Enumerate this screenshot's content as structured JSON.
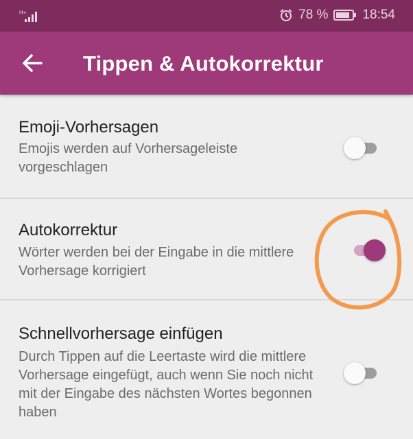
{
  "statusbar": {
    "battery": "78 %",
    "time": "18:54",
    "icons": [
      "signal-icon",
      "alarm-icon",
      "battery-icon"
    ]
  },
  "appbar": {
    "title": "Tippen & Autokorrektur",
    "back_icon": "arrow-left-icon"
  },
  "settings": [
    {
      "title": "Emoji-Vorhersagen",
      "subtitle": "Emojis werden auf Vorhersageleiste vorgeschlagen",
      "enabled": false
    },
    {
      "title": "Autokorrektur",
      "subtitle": "Wörter werden bei der Eingabe in die mittlere Vorhersage korrigiert",
      "enabled": true
    },
    {
      "title": "Schnellvorhersage einfügen",
      "subtitle": "Durch Tippen auf die Leertaste wird die mittlere Vorhersage eingefügt, auch wenn Sie noch nicht mit der Eingabe des nächsten Wortes begonnen haben",
      "enabled": false
    }
  ],
  "colors": {
    "statusbar": "#7e2c5e",
    "appbar": "#9e3a79",
    "accent": "#9e3a79",
    "annotation": "#f39a4c"
  }
}
